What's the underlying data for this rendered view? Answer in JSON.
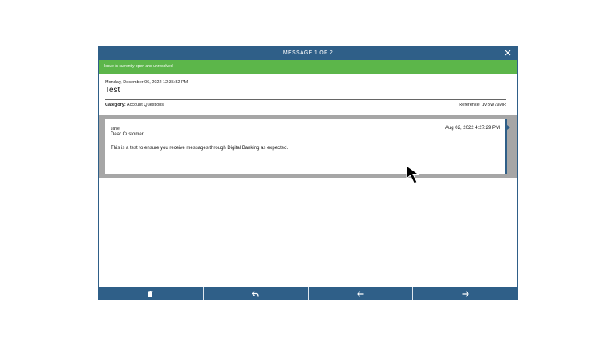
{
  "modal": {
    "title": "MESSAGE 1 OF 2",
    "close_icon": "close-icon",
    "status_text": "Issue is currently open and unresolved",
    "date": "Monday, December 06, 2022 12:35:82 PM",
    "subject": "Test",
    "category_label": "Category:",
    "category_value": " Account Questions",
    "reference": "Reference: 1VBW79MR"
  },
  "message": {
    "sender": "Jane",
    "timestamp": "Aug 02, 2022 4:27:29 PM",
    "greeting": "Dear Customer,",
    "body": "This is a test to ensure you receive messages through Digital Banking as expected."
  },
  "toolbar": {
    "buttons": [
      {
        "icon": "trash-icon"
      },
      {
        "icon": "reply-icon"
      },
      {
        "icon": "arrow-left-icon"
      },
      {
        "icon": "arrow-right-icon"
      }
    ]
  },
  "colors": {
    "header_blue": "#2f5f88",
    "status_green": "#5cb64a",
    "thread_gray": "#a6a6a6"
  }
}
